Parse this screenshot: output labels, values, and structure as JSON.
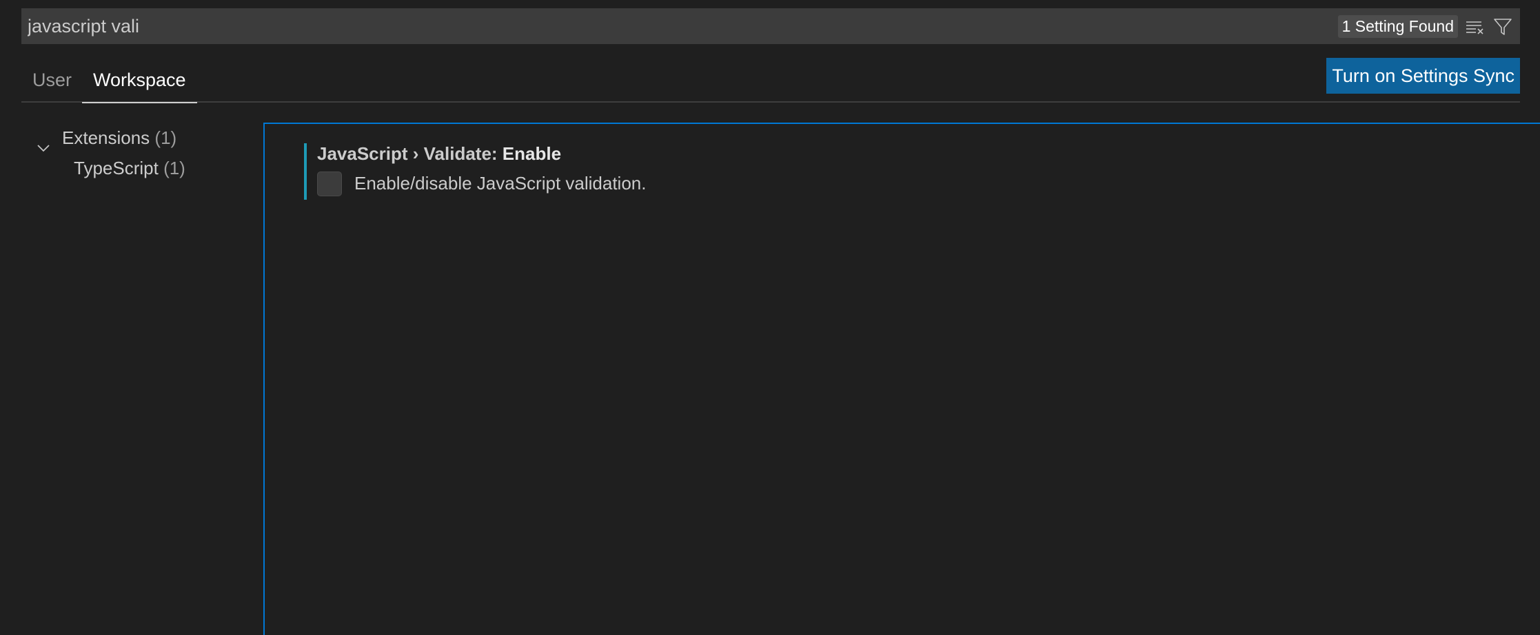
{
  "search": {
    "value": "javascript vali",
    "result_count": "1 Setting Found",
    "clear_icon": "clear-filter-icon",
    "filter_icon": "funnel-icon"
  },
  "tabs": [
    {
      "label": "User",
      "active": false
    },
    {
      "label": "Workspace",
      "active": true
    }
  ],
  "sync_button": {
    "label": "Turn on Settings Sync"
  },
  "toc": {
    "groups": [
      {
        "label": "Extensions",
        "count": "(1)",
        "expanded": true,
        "children": [
          {
            "label": "TypeScript",
            "count": "(1)"
          }
        ]
      }
    ]
  },
  "setting": {
    "category": "JavaScript › Validate: ",
    "key": "Enable",
    "description": "Enable/disable JavaScript validation.",
    "checked": false
  },
  "colors": {
    "background": "#1f1f1f",
    "accent": "#0078d4",
    "button": "#0e639c",
    "modified_indicator": "#1e9bb7"
  }
}
